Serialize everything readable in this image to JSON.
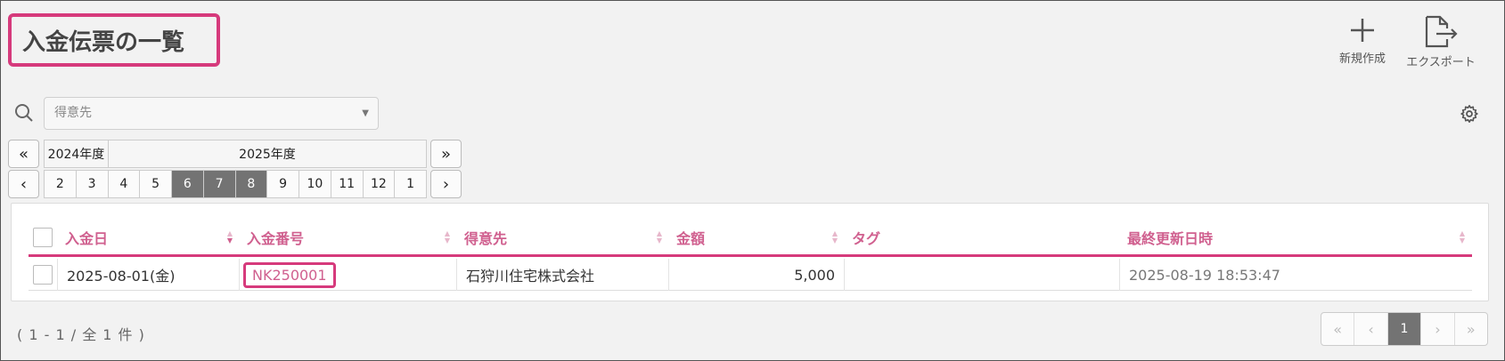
{
  "header": {
    "title": "入金伝票の一覧",
    "new_label": "新規作成",
    "export_label": "エクスポート"
  },
  "filter": {
    "customer_placeholder": "得意先"
  },
  "period": {
    "prev_year_label": "2024年度",
    "current_year_label": "2025年度",
    "months": [
      "2",
      "3",
      "4",
      "5",
      "6",
      "7",
      "8",
      "9",
      "10",
      "11",
      "12",
      "1"
    ],
    "selected_months": [
      "6",
      "7",
      "8"
    ],
    "prev_fast": "«",
    "next_fast": "»",
    "prev": "‹",
    "next": "›"
  },
  "table": {
    "columns": [
      "入金日",
      "入金番号",
      "得意先",
      "金額",
      "タグ",
      "最終更新日時"
    ],
    "rows": [
      {
        "date": "2025-08-01(金)",
        "number": "NK250001",
        "customer": "石狩川住宅株式会社",
        "amount": "5,000",
        "tag": "",
        "updated": "2025-08-19 18:53:47"
      }
    ]
  },
  "footer": {
    "count_text": "( 1 - 1 / 全 1 件 )",
    "current_page": "1"
  },
  "colors": {
    "accent": "#d63a7c",
    "header_text": "#d0608f",
    "selected_bg": "#737373"
  }
}
